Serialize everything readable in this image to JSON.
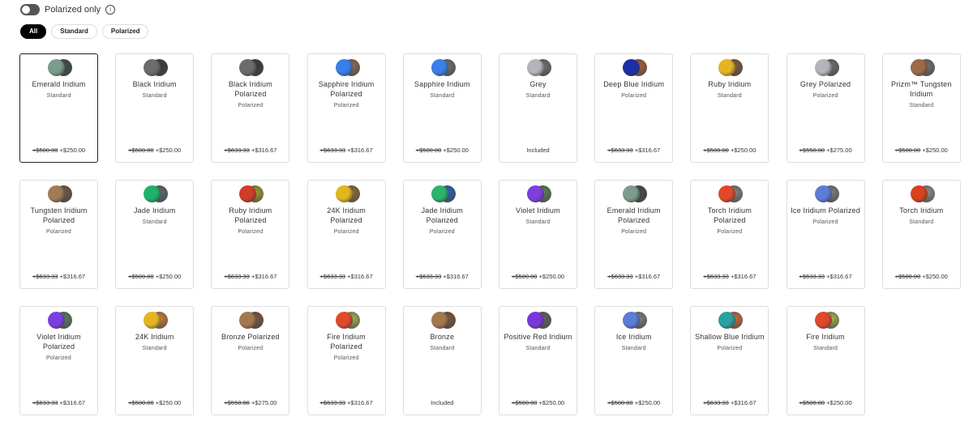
{
  "polarized_toggle": {
    "label": "Polarized only",
    "on": false
  },
  "filters": [
    {
      "label": "All",
      "active": true
    },
    {
      "label": "Standard",
      "active": false
    },
    {
      "label": "Polarized",
      "active": false
    }
  ],
  "lenses": [
    {
      "name": "Emerald Iridium",
      "type": "Standard",
      "old": "+$500.00",
      "price": "+$250.00",
      "selected": true,
      "c1": "#7d9c8e",
      "c2": "#3e4a48"
    },
    {
      "name": "Black Iridium",
      "type": "Standard",
      "old": "+$500.00",
      "price": "+$250.00",
      "c1": "#6c6c6c",
      "c2": "#3a3a3a"
    },
    {
      "name": "Black Iridium Polarized",
      "type": "Polarized",
      "old": "+$633.33",
      "price": "+$316.67",
      "c1": "#6c6c6c",
      "c2": "#3a3a3a"
    },
    {
      "name": "Sapphire Iridium Polarized",
      "type": "Polarized",
      "old": "+$633.33",
      "price": "+$316.67",
      "c1": "#3b7ee6",
      "c2": "#8a6a4e"
    },
    {
      "name": "Sapphire Iridium",
      "type": "Standard",
      "old": "+$500.00",
      "price": "+$250.00",
      "c1": "#3b7ee6",
      "c2": "#6d6d6d"
    },
    {
      "name": "Grey",
      "type": "Standard",
      "old": "",
      "price": "Included",
      "c1": "#b4b4bb",
      "c2": "#6b6b72"
    },
    {
      "name": "Deep Blue Iridium",
      "type": "Polarized",
      "old": "+$633.33",
      "price": "+$316.67",
      "c1": "#1d2fa6",
      "c2": "#a55a3e"
    },
    {
      "name": "Ruby Iridium",
      "type": "Standard",
      "old": "+$500.00",
      "price": "+$250.00",
      "c1": "#e6b422",
      "c2": "#7a5a3a"
    },
    {
      "name": "Grey Polarized",
      "type": "Polarized",
      "old": "+$550.00",
      "price": "+$275.00",
      "c1": "#b4b4bb",
      "c2": "#6b6b72"
    },
    {
      "name": "Prizm™ Tungsten Iridium",
      "type": "Standard",
      "old": "+$500.00",
      "price": "+$250.00",
      "c1": "#9b6a48",
      "c2": "#6e6e6e"
    },
    {
      "name": "Tungsten Iridium Polarized",
      "type": "Polarized",
      "old": "+$633.33",
      "price": "+$316.67",
      "c1": "#a17a58",
      "c2": "#6b5846"
    },
    {
      "name": "Jade Iridium",
      "type": "Standard",
      "old": "+$500.00",
      "price": "+$250.00",
      "c1": "#1fb36a",
      "c2": "#5f6470"
    },
    {
      "name": "Ruby Iridium Polarized",
      "type": "Polarized",
      "old": "+$633.33",
      "price": "+$316.67",
      "c1": "#d23c2a",
      "c2": "#9c9a30"
    },
    {
      "name": "24K Iridium Polarized",
      "type": "Polarized",
      "old": "+$633.33",
      "price": "+$316.67",
      "c1": "#e0b720",
      "c2": "#8a6a3c"
    },
    {
      "name": "Jade Iridium Polarized",
      "type": "Polarized",
      "old": "+$633.33",
      "price": "+$316.67",
      "c1": "#2bb36b",
      "c2": "#2f5fae"
    },
    {
      "name": "Violet Iridium",
      "type": "Standard",
      "old": "+$500.00",
      "price": "+$250.00",
      "c1": "#7c3fe0",
      "c2": "#5a7a58"
    },
    {
      "name": "Emerald Iridium Polarized",
      "type": "Polarized",
      "old": "+$633.33",
      "price": "+$316.67",
      "c1": "#7d9c8e",
      "c2": "#3e4a48"
    },
    {
      "name": "Torch Iridium Polarized",
      "type": "Polarized",
      "old": "+$633.33",
      "price": "+$316.67",
      "c1": "#e0482a",
      "c2": "#808080"
    },
    {
      "name": "Ice Iridium Polarized",
      "type": "Polarized",
      "old": "+$633.33",
      "price": "+$316.67",
      "c1": "#5d7cd6",
      "c2": "#7b7b7b"
    },
    {
      "name": "Torch Iridium",
      "type": "Standard",
      "old": "+$500.00",
      "price": "+$250.00",
      "c1": "#d8421f",
      "c2": "#8a8a8a"
    },
    {
      "name": "Violet Iridium Polarized",
      "type": "Polarized",
      "old": "+$633.33",
      "price": "+$316.67",
      "c1": "#7c3fe0",
      "c2": "#5a7a58"
    },
    {
      "name": "24K Iridium",
      "type": "Standard",
      "old": "+$500.00",
      "price": "+$250.00",
      "c1": "#e6b422",
      "c2": "#c87a38"
    },
    {
      "name": "Bronze Polarized",
      "type": "Polarized",
      "old": "+$550.00",
      "price": "+$275.00",
      "c1": "#a4784e",
      "c2": "#7a5538"
    },
    {
      "name": "Fire Iridium Polarized",
      "type": "Polarized",
      "old": "+$633.33",
      "price": "+$316.67",
      "c1": "#e0482a",
      "c2": "#a0b050"
    },
    {
      "name": "Bronze",
      "type": "Standard",
      "old": "",
      "price": "Included",
      "c1": "#a4784e",
      "c2": "#7a5538"
    },
    {
      "name": "Positive Red Iridium",
      "type": "Standard",
      "old": "+$500.00",
      "price": "+$250.00",
      "c1": "#7a38d8",
      "c2": "#606060"
    },
    {
      "name": "Ice Iridium",
      "type": "Standard",
      "old": "+$500.00",
      "price": "+$250.00",
      "c1": "#5d7cd6",
      "c2": "#7b7b7b"
    },
    {
      "name": "Shallow Blue Iridium",
      "type": "Polarized",
      "old": "+$633.33",
      "price": "+$316.67",
      "c1": "#2aa0a0",
      "c2": "#c26a3a"
    },
    {
      "name": "Fire Iridium",
      "type": "Standard",
      "old": "+$500.00",
      "price": "+$250.00",
      "c1": "#e0482a",
      "c2": "#a0b050"
    }
  ]
}
